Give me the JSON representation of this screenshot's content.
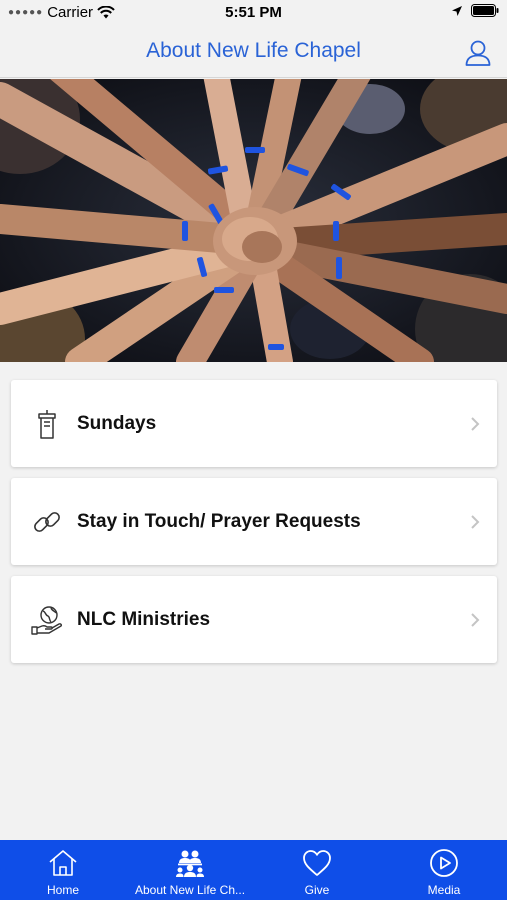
{
  "status_bar": {
    "carrier": "Carrier",
    "time": "5:51 PM"
  },
  "nav": {
    "title": "About New Life Chapel",
    "profile_icon": "person-icon"
  },
  "hero_image": {
    "subject": "group-hands-together-photo"
  },
  "menu": [
    {
      "label": "Sundays",
      "icon": "podium-icon"
    },
    {
      "label": "Stay in Touch/ Prayer Requests",
      "icon": "link-icon"
    },
    {
      "label": "NLC Ministries",
      "icon": "hand-globe-icon"
    }
  ],
  "tab_bar": {
    "tabs": [
      {
        "label": "Home",
        "icon": "home-icon"
      },
      {
        "label": "About New Life Ch...",
        "icon": "people-icon"
      },
      {
        "label": "Give",
        "icon": "heart-icon"
      },
      {
        "label": "Media",
        "icon": "play-icon"
      }
    ]
  },
  "colors": {
    "accent": "#2a63d6",
    "tab_bar_bg": "#0f4ee8",
    "background": "#f2f2f2"
  }
}
